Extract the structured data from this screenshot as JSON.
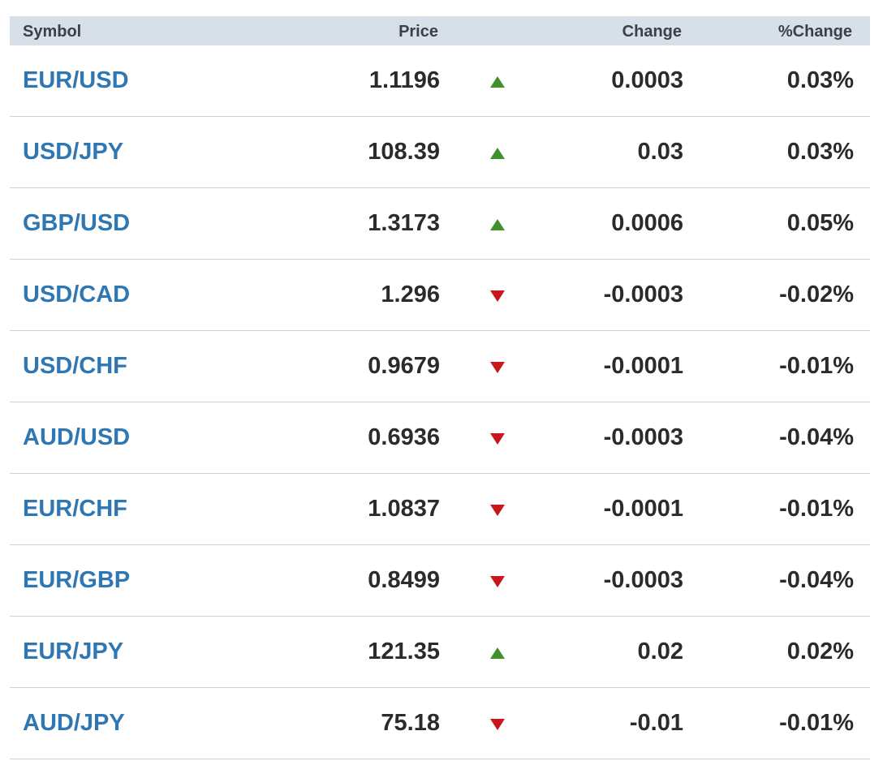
{
  "colors": {
    "header_bg": "#d7e0e8",
    "symbol_link": "#2f77b3",
    "up": "#3f8f2b",
    "down": "#c8161d",
    "divider": "#c9d3dc"
  },
  "table": {
    "headers": {
      "symbol": "Symbol",
      "price": "Price",
      "change": "Change",
      "pct_change": "%Change"
    },
    "rows": [
      {
        "symbol": "EUR/USD",
        "price": "1.1196",
        "direction": "up",
        "change": "0.0003",
        "pct_change": "0.03%"
      },
      {
        "symbol": "USD/JPY",
        "price": "108.39",
        "direction": "up",
        "change": "0.03",
        "pct_change": "0.03%"
      },
      {
        "symbol": "GBP/USD",
        "price": "1.3173",
        "direction": "up",
        "change": "0.0006",
        "pct_change": "0.05%"
      },
      {
        "symbol": "USD/CAD",
        "price": "1.296",
        "direction": "down",
        "change": "-0.0003",
        "pct_change": "-0.02%"
      },
      {
        "symbol": "USD/CHF",
        "price": "0.9679",
        "direction": "down",
        "change": "-0.0001",
        "pct_change": "-0.01%"
      },
      {
        "symbol": "AUD/USD",
        "price": "0.6936",
        "direction": "down",
        "change": "-0.0003",
        "pct_change": "-0.04%"
      },
      {
        "symbol": "EUR/CHF",
        "price": "1.0837",
        "direction": "down",
        "change": "-0.0001",
        "pct_change": "-0.01%"
      },
      {
        "symbol": "EUR/GBP",
        "price": "0.8499",
        "direction": "down",
        "change": "-0.0003",
        "pct_change": "-0.04%"
      },
      {
        "symbol": "EUR/JPY",
        "price": "121.35",
        "direction": "up",
        "change": "0.02",
        "pct_change": "0.02%"
      },
      {
        "symbol": "AUD/JPY",
        "price": "75.18",
        "direction": "down",
        "change": "-0.01",
        "pct_change": "-0.01%"
      }
    ]
  }
}
